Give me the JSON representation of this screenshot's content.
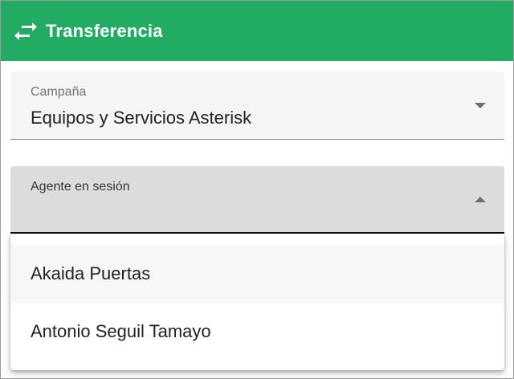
{
  "header": {
    "icon": "swap-horizontal-icon",
    "title": "Transferencia",
    "background_color": "#22ac63"
  },
  "campana": {
    "label": "Campaña",
    "value": "Equipos y Servicios Asterisk",
    "arrow_icon": "chevron-down-icon"
  },
  "agente": {
    "label": "Agente en sesión",
    "value": "",
    "arrow_icon": "chevron-up-icon",
    "expanded": true
  },
  "dropdown": {
    "options": [
      {
        "label": "Akaida Puertas",
        "highlighted": true
      },
      {
        "label": "Antonio Seguil Tamayo",
        "highlighted": false
      }
    ]
  }
}
